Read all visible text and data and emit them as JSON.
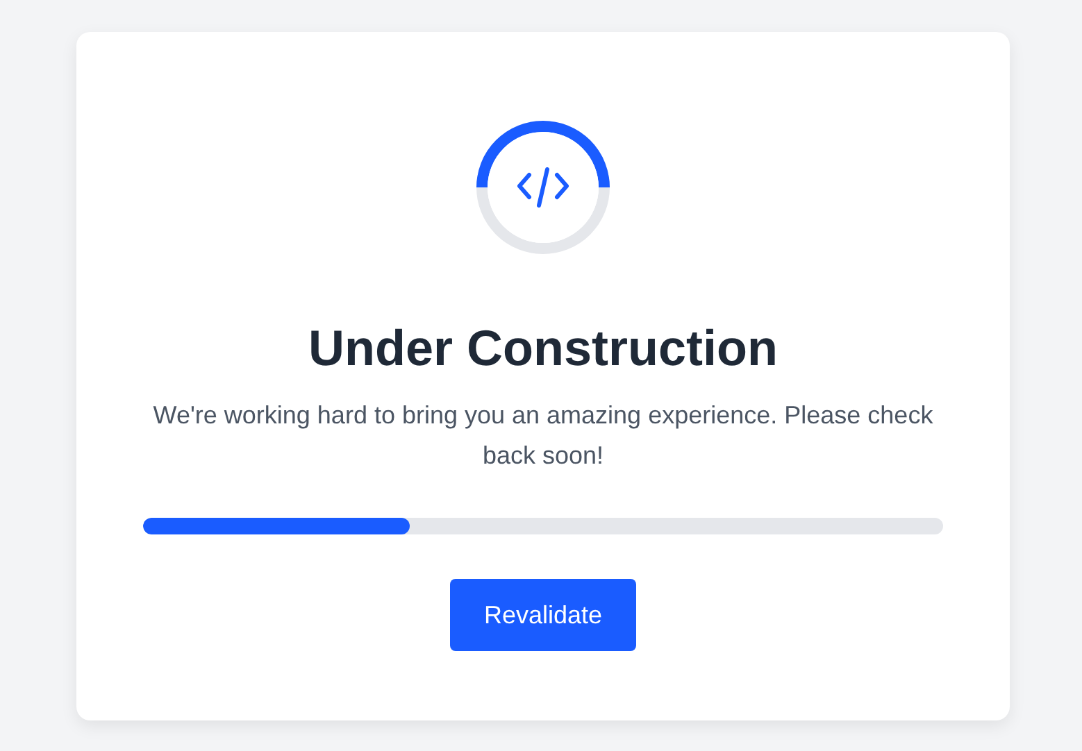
{
  "title": "Under Construction",
  "message": "We're working hard to bring you an amazing experience. Please check back soon!",
  "progress": {
    "level": 0.333
  },
  "button": {
    "label": "Revalidate"
  }
}
